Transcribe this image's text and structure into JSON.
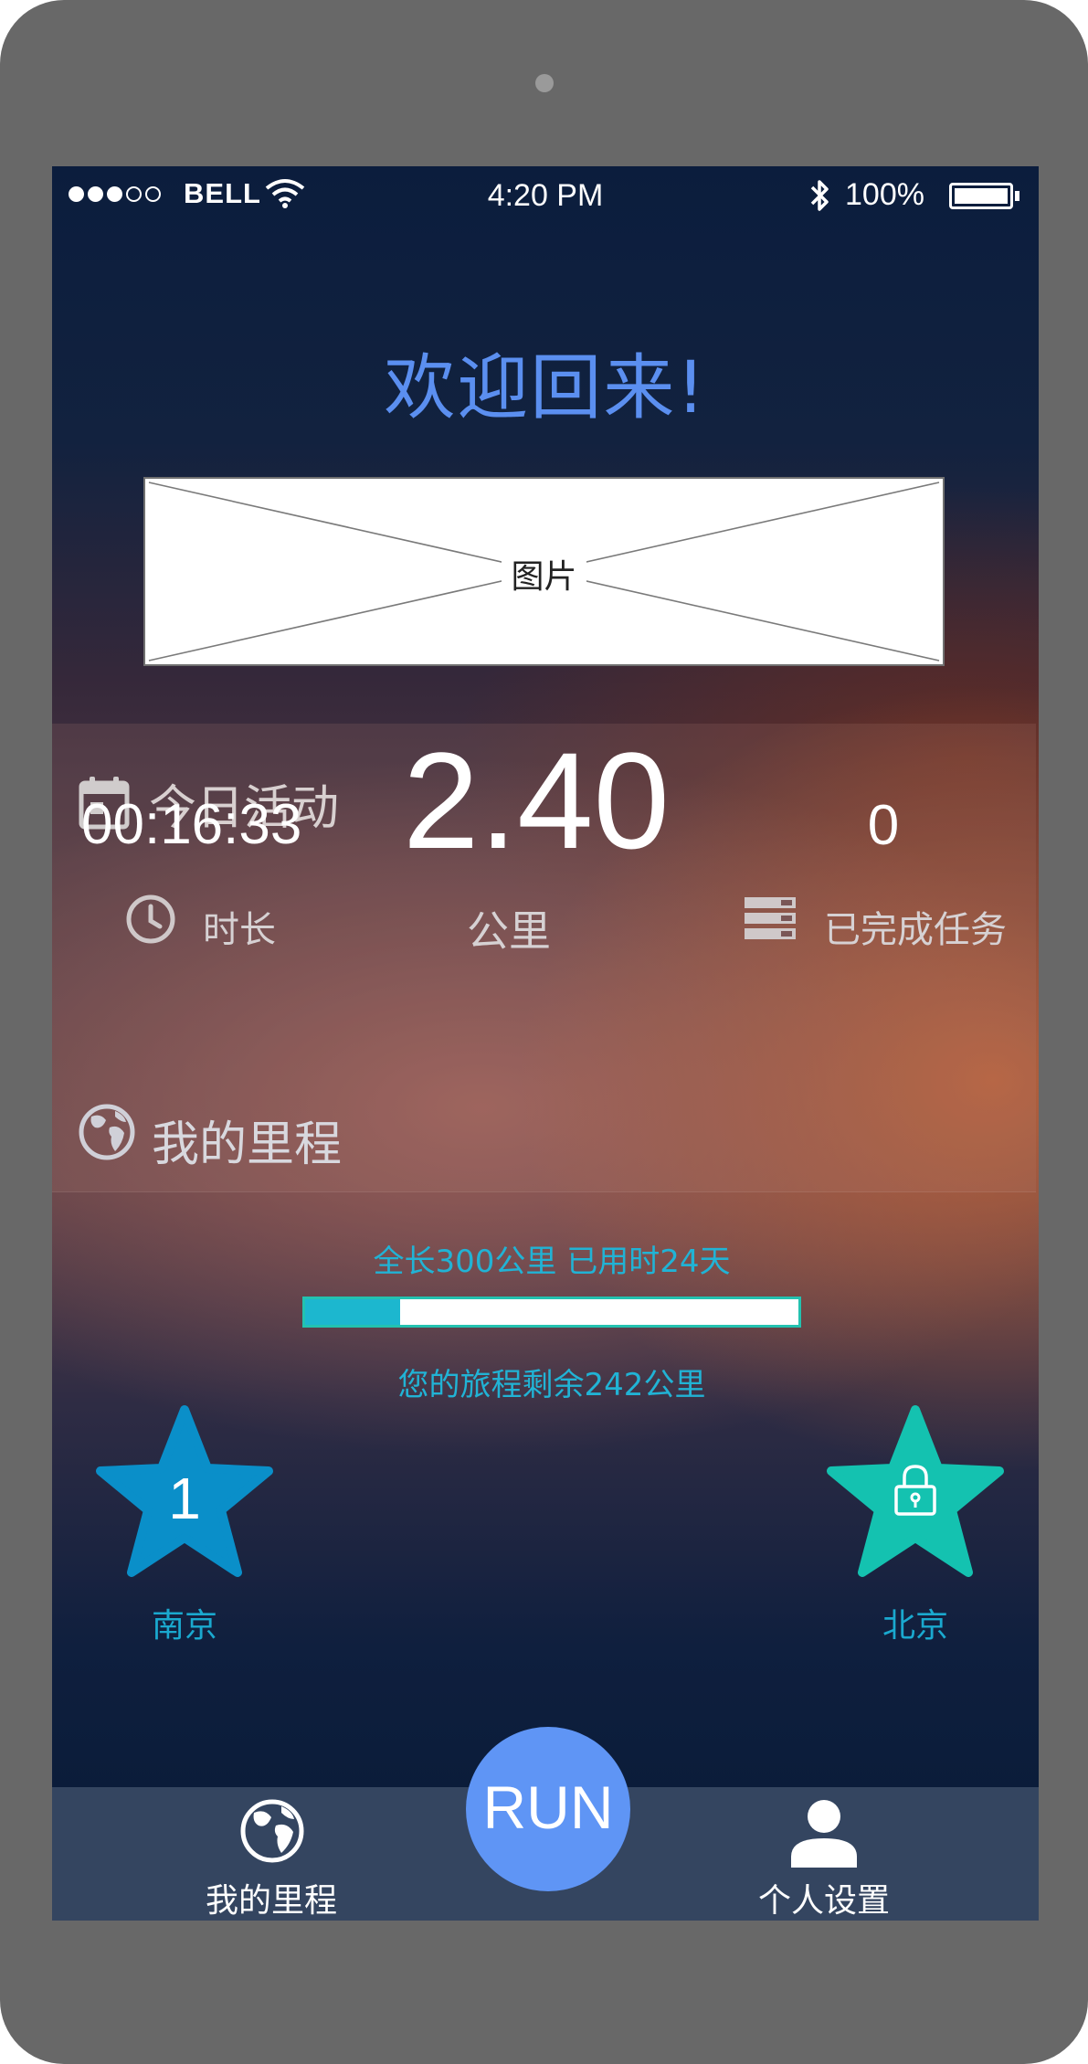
{
  "status_bar": {
    "carrier": "BELL",
    "time": "4:20 PM",
    "battery": "100%",
    "signal_bars_filled": 3,
    "signal_bars_total": 5
  },
  "welcome": "欢迎回来!",
  "image_placeholder": "图片",
  "today": {
    "title": "今日活动",
    "duration": "00:16:33",
    "duration_label": "时长",
    "distance": "2.40",
    "distance_label": "公里",
    "tasks": "0",
    "tasks_label": "已完成任务"
  },
  "mileage": {
    "title": "我的里程",
    "start_city": "南京",
    "start_level": "1",
    "end_city": "北京",
    "summary": "全长300公里 已用时24天",
    "remaining": "您的旅程剩余242公里",
    "progress_fraction": 0.193
  },
  "tabbar": {
    "left_label": "我的里程",
    "run_label": "RUN",
    "right_label": "个人设置"
  },
  "colors": {
    "welcome": "#5b8ff0",
    "start_star": "#0a8fc9",
    "end_star": "#14c2b0",
    "progress_fill": "#1cb7cf",
    "run_button": "#5f95f5",
    "tabbar": "#344560"
  }
}
